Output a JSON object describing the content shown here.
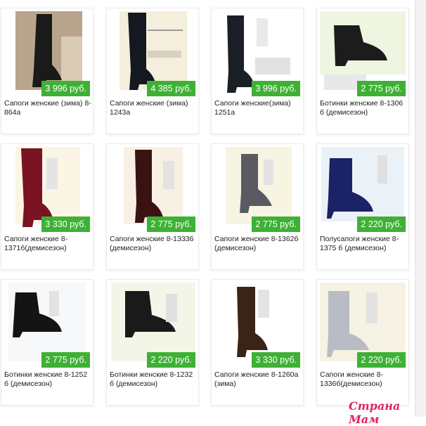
{
  "products": [
    {
      "title": "Сапоги женские (зима) 8-864а",
      "price": "3 996 руб.",
      "image": "tall-boot-black-photo"
    },
    {
      "title": "Сапоги женские (зима) 1243а",
      "price": "4 385 руб.",
      "image": "tall-boot-black-suede"
    },
    {
      "title": "Сапоги женские(зима) 1251а",
      "price": "3 996 руб.",
      "image": "tall-boot-black"
    },
    {
      "title": "Ботинки женские 8-1306 б (демисезон)",
      "price": "2 775 руб.",
      "image": "ankle-boot-black-studs"
    },
    {
      "title": "Сапоги женские 8-1371б(демисезон)",
      "price": "3 330 руб.",
      "image": "tall-boot-burgundy"
    },
    {
      "title": "Сапоги женские 8-1333б (демисезон)",
      "price": "2 775 руб.",
      "image": "tall-boot-dark-red"
    },
    {
      "title": "Сапоги женские 8-1362б (демисезон)",
      "price": "2 775 руб.",
      "image": "mid-boot-grey"
    },
    {
      "title": "Полусапоги женские 8-1375 б (демисезон)",
      "price": "2 220 руб.",
      "image": "mid-boot-navy"
    },
    {
      "title": "Ботинки женские 8-1252 б (демисезон)",
      "price": "2 775 руб.",
      "image": "lace-boot-black"
    },
    {
      "title": "Ботинки женские 8-1232 б (демисезон)",
      "price": "2 220 руб.",
      "image": "lace-boot-black-buckle"
    },
    {
      "title": "Сапоги женские 8-1260а (зима)",
      "price": "3 330 руб.",
      "image": "mid-boot-brown"
    },
    {
      "title": "Сапоги женские 8-1336б(демисезон)",
      "price": "2 220 руб.",
      "image": "mid-boot-silver"
    }
  ],
  "watermark": "Страна Мам",
  "colors": {
    "price_badge": "#3eb135"
  }
}
